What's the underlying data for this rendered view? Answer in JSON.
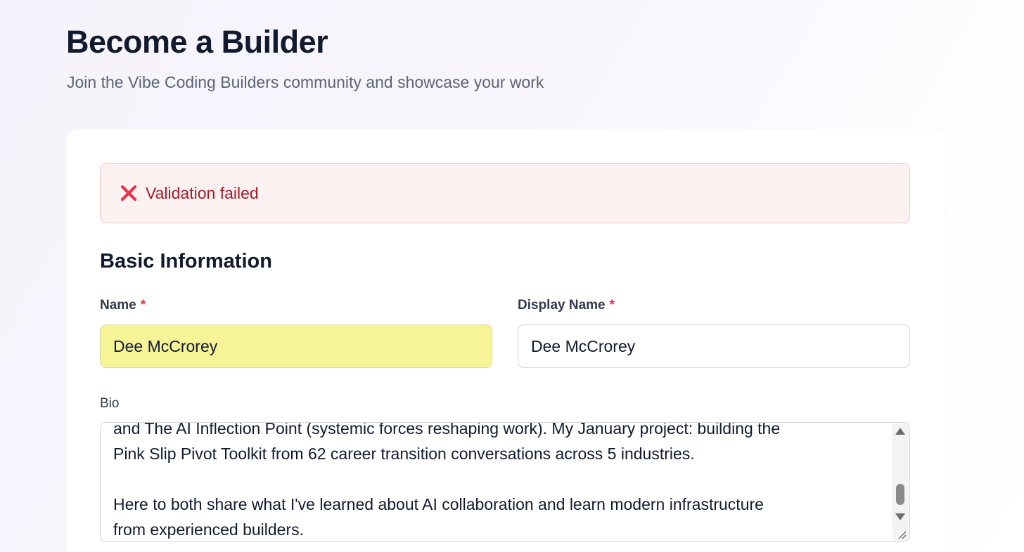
{
  "header": {
    "title": "Become a Builder",
    "subtitle": "Join the Vibe Coding Builders community and showcase your work"
  },
  "alert": {
    "icon": "x-mark-icon",
    "color": "#e8344a",
    "message": "Validation failed"
  },
  "basic_info": {
    "section_title": "Basic Information",
    "name": {
      "label": "Name",
      "required_marker": "*",
      "value": "Dee McCrorey"
    },
    "display_name": {
      "label": "Display Name",
      "required_marker": "*",
      "value": "Dee McCrorey"
    },
    "bio": {
      "label": "Bio",
      "lines": [
        "and The AI Inflection Point (systemic forces reshaping work). My January project: building the",
        "Pink Slip Pivot Toolkit from 62 career transition conversations across 5 industries.",
        "",
        "Here to both share what I've learned about AI collaboration and learn modern infrastructure",
        "from experienced builders."
      ]
    }
  },
  "colors": {
    "accent_error": "#9f1d2a",
    "required": "#e0344a",
    "autofill": "#f6f496"
  }
}
